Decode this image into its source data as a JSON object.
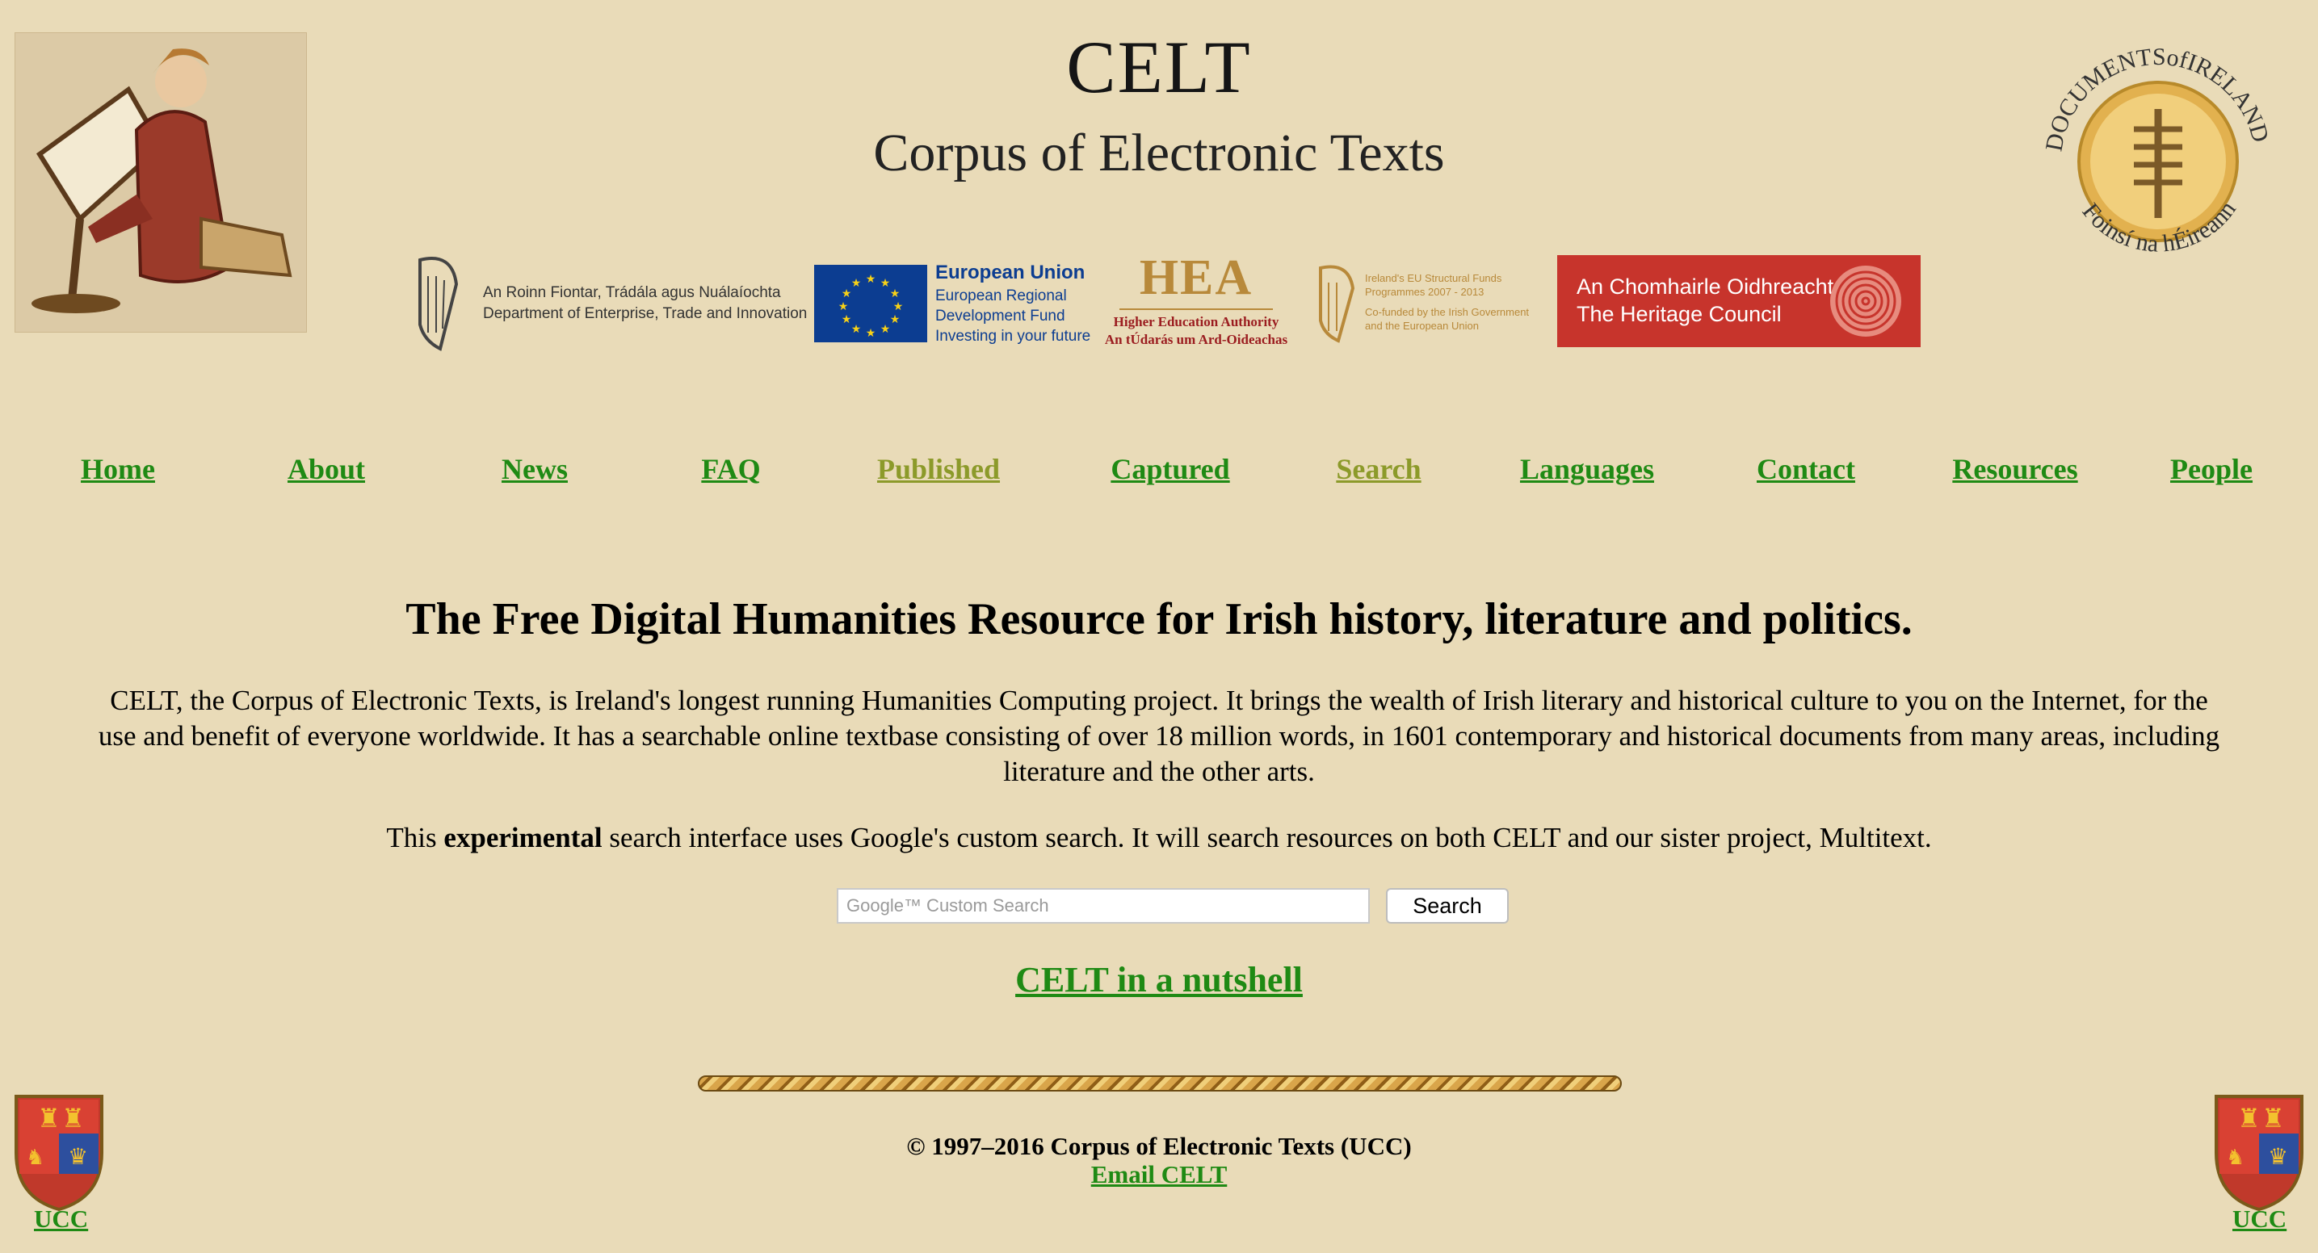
{
  "header": {
    "title": "CELT",
    "subtitle": "Corpus of Electronic Texts",
    "left_image": "illuminated-scribe-image",
    "right_logo": {
      "name": "documents-of-ireland-logo",
      "text_top": "DOCUMENTSofIRELAND",
      "text_bottom": "Foinsí na hÉireann"
    }
  },
  "sponsors": {
    "dept": {
      "line1": "An Roinn Fiontar, Trádála agus Nuálaíochta",
      "line2": "Department of Enterprise, Trade and Innovation"
    },
    "eu": {
      "title": "European Union",
      "line1": "European Regional",
      "line2": "Development Fund",
      "line3": "Investing in your future"
    },
    "hea": {
      "big": "HEA",
      "line1": "Higher Education Authority",
      "line2": "An tÚdarás um Ard-Oideachas"
    },
    "structural": {
      "line1": "Ireland's EU Structural Funds",
      "line2": "Programmes 2007 - 2013",
      "line3": "Co-funded by the Irish Government",
      "line4": "and the European Union"
    },
    "heritage": {
      "line1": "An Chomhairle Oidhreachta",
      "line2": "The Heritage Council"
    }
  },
  "nav": {
    "home": "Home",
    "about": "About",
    "news": "News",
    "faq": "FAQ",
    "published": "Published",
    "captured": "Captured",
    "search": "Search",
    "languages": "Languages",
    "contact": "Contact",
    "resources": "Resources",
    "people": "People"
  },
  "main": {
    "headline": "The Free Digital Humanities Resource for Irish history, literature and politics.",
    "intro": "CELT, the Corpus of Electronic Texts, is Ireland's longest running Humanities Computing project. It brings the wealth of Irish literary and historical culture to you on the Internet, for the use and benefit of everyone worldwide. It has a searchable online textbase consisting of over 18 million words, in 1601 contemporary and historical documents from many areas, including literature and the other arts.",
    "search_note_pre": "This ",
    "search_note_bold": "experimental",
    "search_note_post": " search interface uses Google's custom search. It will search resources on both CELT and our sister project, Multitext.",
    "search_placeholder": "Google™ Custom Search",
    "search_button": "Search",
    "nutshell_link": "CELT in a nutshell"
  },
  "footer": {
    "copyright": "© 1997–2016 Corpus of Electronic Texts (UCC)",
    "email_link": "Email CELT",
    "ucc_left": "UCC",
    "ucc_right": "UCC"
  },
  "colors": {
    "background": "#e9dbb8",
    "link": "#1f8a14",
    "link_alt": "#8c9a2a",
    "eu_blue": "#0c3d91",
    "heritage_red": "#c7342c",
    "hea_gold": "#b8893a"
  }
}
